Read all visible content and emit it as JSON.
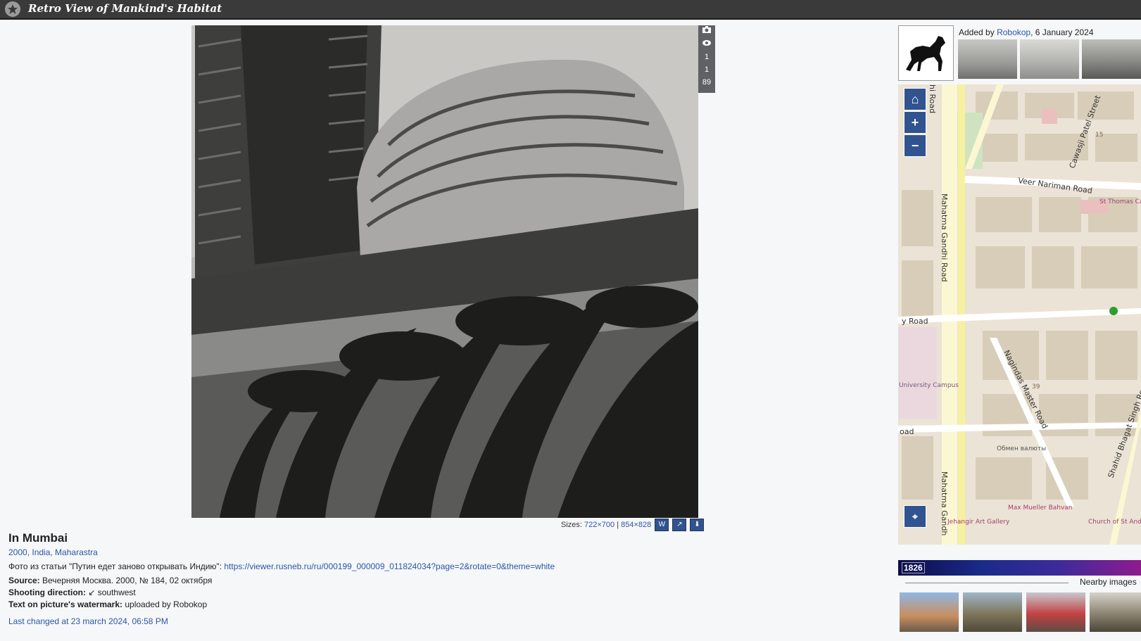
{
  "header": {
    "site_title": "Retro View of Mankind's Habitat",
    "logo_icon": "star-circle-icon"
  },
  "photo": {
    "counters": [
      "1",
      "1",
      "89"
    ],
    "icons": [
      "camera-icon",
      "eye-icon"
    ]
  },
  "sizes": {
    "label": "Sizes:",
    "size1": "722×700",
    "separator": "|",
    "size2": "854×828",
    "buttons": [
      "W",
      "↗",
      "⬇"
    ]
  },
  "info": {
    "title": "In Mumbai",
    "meta": "2000, India, Maharastra",
    "desc_text": "Фото из статьи \"Путин едет заново открывать Индию\":",
    "desc_link": "https://viewer.rusneb.ru/ru/000199_000009_011824034?page=2&rotate=0&theme=white",
    "source_label": "Source:",
    "source_value": "Вечерняя Москва. 2000, № 184, 02 октября",
    "direction_label": "Shooting direction:",
    "direction_value": "↙ southwest",
    "watermark_label": "Text on picture's watermark:",
    "watermark_value": "uploaded by Robokop",
    "last_changed": "Last changed at 23 march 2024, 06:58 PM"
  },
  "right": {
    "added_prefix": "Added by",
    "added_user": "Robokop",
    "added_date": ", 6 January 2024",
    "timeline_year": "1826",
    "nearby": "Nearby images"
  },
  "map": {
    "streets": [
      "Mahatma Gandhi Road",
      "Veer Nariman Road",
      "Nagindas Master Road",
      "Cawasji Patel Street",
      "Shahid Bhagat Singh Road",
      "Mahatma Gandh"
    ],
    "places": [
      "St Thomas Cathedral",
      "Jehangir Art Gallery",
      "Max Mueller Bahvan",
      "Church of St Andrew and St Columba",
      "Обмен валюты",
      "University Campus",
      "y Road",
      "oad",
      "hi Road",
      "15",
      "39"
    ],
    "controls": [
      "home-icon",
      "zoom-in-icon",
      "zoom-out-icon",
      "location-pin-icon"
    ]
  }
}
